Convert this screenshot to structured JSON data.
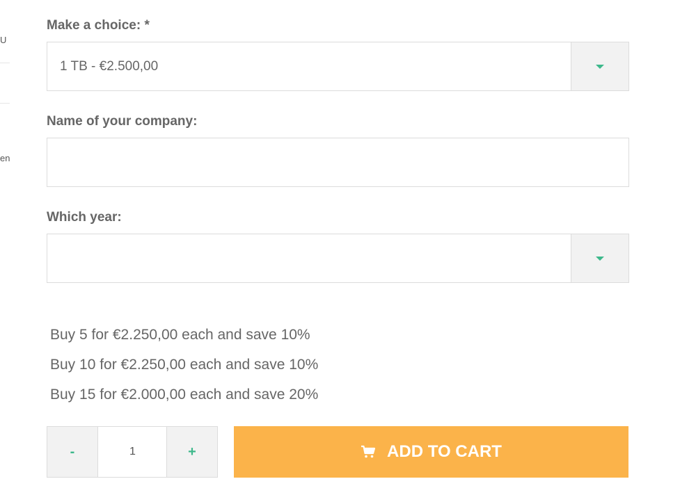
{
  "sidebar_fragments": {
    "fragment_1": "U",
    "fragment_2": "en"
  },
  "form": {
    "choice": {
      "label": "Make a choice: *",
      "selected": "1 TB - €2.500,00"
    },
    "company": {
      "label": "Name of your company:",
      "value": ""
    },
    "year": {
      "label": "Which year:",
      "selected": ""
    }
  },
  "offers": [
    "Buy 5 for €2.250,00 each and save 10%",
    "Buy 10 for €2.250,00 each and save 10%",
    "Buy 15 for €2.000,00 each and save 20%"
  ],
  "quantity": {
    "minus": "-",
    "value": "1",
    "plus": "+"
  },
  "cart": {
    "label": "ADD TO CART",
    "icon": "cart-icon"
  },
  "colors": {
    "accent": "#3db88b",
    "cart_button": "#fbb34a",
    "text": "#666666"
  }
}
